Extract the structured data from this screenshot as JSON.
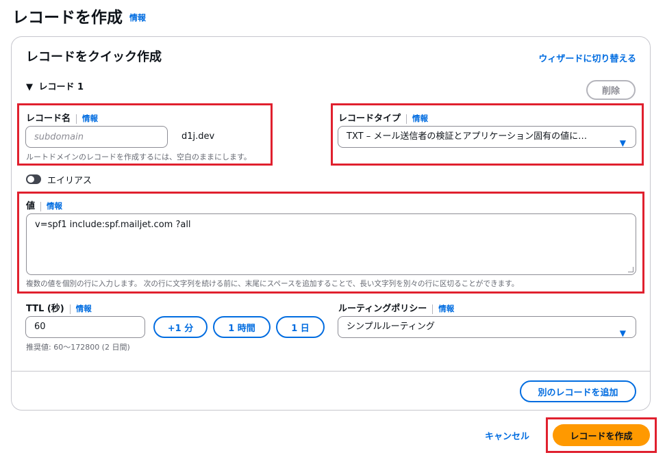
{
  "page": {
    "title": "レコードを作成",
    "info": "情報"
  },
  "card": {
    "title": "レコードをクイック作成",
    "wizard_link": "ウィザードに切り替える"
  },
  "record": {
    "section_label": "レコード 1",
    "delete_label": "削除",
    "name": {
      "label": "レコード名",
      "info": "情報",
      "placeholder": "subdomain",
      "suffix": "d1j.dev",
      "hint": "ルートドメインのレコードを作成するには、空白のままにします。"
    },
    "type": {
      "label": "レコードタイプ",
      "info": "情報",
      "selected": "TXT – メール送信者の検証とアプリケーション固有の値に…"
    },
    "alias": {
      "label": "エイリアス",
      "enabled": false
    },
    "value": {
      "label": "値",
      "info": "情報",
      "text": "v=spf1 include:spf.mailjet.com ?all",
      "hint": "複数の値を個別の行に入力します。 次の行に文字列を続ける前に、末尾にスペースを追加することで、長い文字列を別々の行に区切ることができます。"
    },
    "ttl": {
      "label": "TTL (秒)",
      "info": "情報",
      "value": "60",
      "hint": "推奨値: 60〜172800 (2 日間)",
      "buttons": [
        "+1 分",
        "1 時間",
        "1 日"
      ]
    },
    "routing": {
      "label": "ルーティングポリシー",
      "info": "情報",
      "selected": "シンプルルーティング"
    }
  },
  "add_record_label": "別のレコードを追加",
  "footer": {
    "cancel": "キャンセル",
    "create": "レコードを作成"
  },
  "colors": {
    "link": "#006ce0",
    "primary_button": "#ff9900",
    "highlight": "#e0202e"
  },
  "icons": {
    "caret": "caret-down-icon",
    "section": "triangle-down-icon"
  }
}
